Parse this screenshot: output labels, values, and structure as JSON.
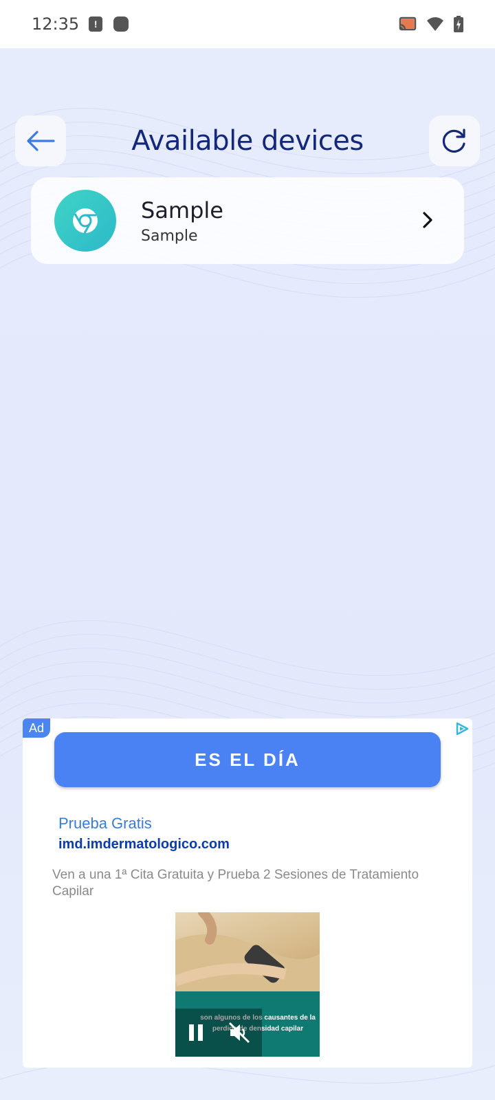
{
  "status_bar": {
    "time": "12:35",
    "alert_icon_text": "!"
  },
  "header": {
    "title": "Available devices",
    "back_icon": "arrow-left-icon",
    "refresh_icon": "refresh-icon"
  },
  "devices": [
    {
      "name": "Sample",
      "subtitle": "Sample",
      "icon": "chrome-icon"
    }
  ],
  "ad": {
    "badge": "Ad",
    "cta": "ES EL DÍA",
    "headline": "Prueba Gratis",
    "url": "imd.imdermatologico.com",
    "description": "Ven a una 1ª Cita Gratuita y Prueba 2 Sesiones de Tratamiento Capilar",
    "video_caption": "son algunos de los causantes de la perdida de densidad capilar"
  },
  "colors": {
    "accent": "#4a82f3",
    "title": "#13287a",
    "device_icon": "#3fd4c6"
  }
}
